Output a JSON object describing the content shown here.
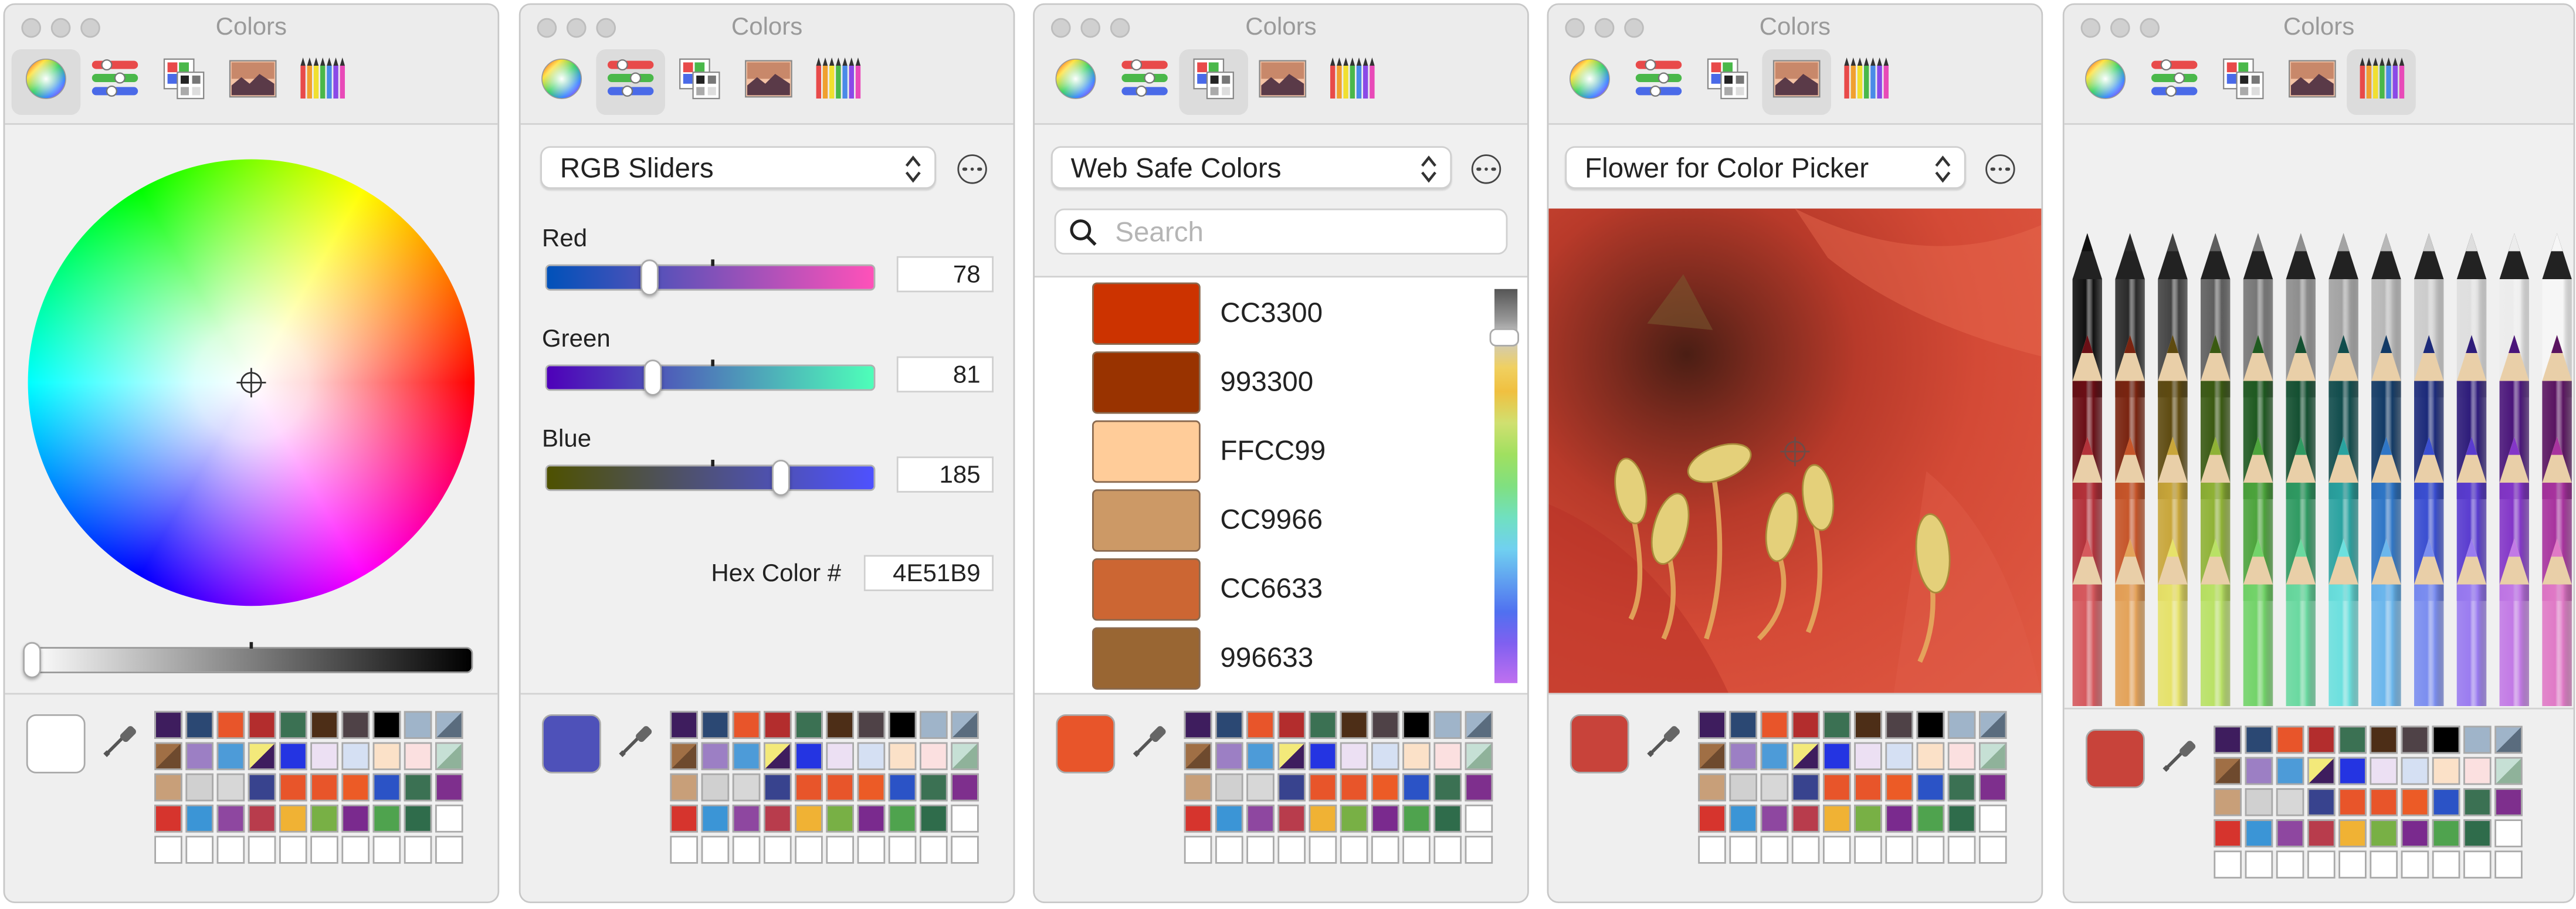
{
  "windows": [
    {
      "title": "Colors",
      "active_tab": 0
    },
    {
      "title": "Colors",
      "active_tab": 1
    },
    {
      "title": "Colors",
      "active_tab": 2
    },
    {
      "title": "Colors",
      "active_tab": 3
    },
    {
      "title": "Colors",
      "active_tab": 4
    }
  ],
  "toolbar_tabs": [
    "color-wheel-icon",
    "color-sliders-icon",
    "color-palettes-icon",
    "image-palettes-icon",
    "pencils-icon"
  ],
  "wheel": {
    "current_color": "#ffffff"
  },
  "sliders": {
    "mode": "RGB Sliders",
    "red_label": "Red",
    "red_value": "78",
    "green_label": "Green",
    "green_value": "81",
    "blue_label": "Blue",
    "blue_value": "185",
    "hex_label": "Hex Color #",
    "hex_value": "4E51B9",
    "current_color": "#4E51B9"
  },
  "palettes": {
    "list_name": "Web Safe Colors",
    "search_placeholder": "Search",
    "items": [
      {
        "name": "CC3300",
        "color": "#CC3300"
      },
      {
        "name": "993300",
        "color": "#993300"
      },
      {
        "name": "FFCC99",
        "color": "#FFCC99"
      },
      {
        "name": "CC9966",
        "color": "#CC9966"
      },
      {
        "name": "CC6633",
        "color": "#CC6633"
      },
      {
        "name": "996633",
        "color": "#996633"
      }
    ],
    "current_color": "#e8552a"
  },
  "image": {
    "image_name": "Flower for Color Picker",
    "current_color": "#c8433a"
  },
  "pencils": {
    "current_color": "#c8433a"
  },
  "favorites": [
    "#3e1d5e",
    "#2b4873",
    "#e8552a",
    "#b32d2d",
    "#3b7153",
    "#4d2e17",
    "#4f4247",
    "#000000",
    "#9fb4c9",
    "#8fb29a",
    "#a06f45",
    "#9c7fc4",
    "#4d9bd8",
    "#f3e97a",
    "#2434e2",
    "#ece0f3",
    "#d5e0f3",
    "#fbe1c8",
    "#fbe0e0",
    "#c6e0d5",
    "#c89f79",
    "#d0d0d0",
    "#d7d7d7",
    "#38438e",
    "#e8552a",
    "#e8552a",
    "#ec5b26",
    "#2b53c6",
    "#3b7153",
    "#7e2f8d",
    "#d6342d",
    "#3b95d6",
    "#8e47a0",
    "#b83c4c",
    "#f0b234",
    "#78b045",
    "#7a2a8e",
    "#4fa34e",
    "#2f6c4b",
    "#ffffff",
    "#ffffff",
    "#ffffff",
    "#ffffff",
    "#ffffff",
    "#ffffff",
    "#ffffff",
    "#ffffff",
    "#ffffff",
    "#ffffff",
    "#ffffff"
  ],
  "pencil_colors": [
    [
      "#111111",
      "#2a2a2a",
      "#444444",
      "#5e5e5e",
      "#777777",
      "#8e8e8e",
      "#a3a3a3",
      "#b8b8b8",
      "#cccccc",
      "#dedede",
      "#ececec",
      "#f6f6f6"
    ],
    [
      "#6b0f16",
      "#7a2410",
      "#5e4a10",
      "#3a5a12",
      "#1f5a20",
      "#145032",
      "#114d4d",
      "#123a66",
      "#1c2a7a",
      "#2e1c7a",
      "#4a157a",
      "#5a1460"
    ],
    [
      "#b3323a",
      "#c6562a",
      "#c9a63a",
      "#8fb236",
      "#4da43c",
      "#2f9a62",
      "#2aa3a0",
      "#2f76c6",
      "#3a4fd1",
      "#5a3ccf",
      "#8436c8",
      "#a8339e"
    ],
    [
      "#d65a5e",
      "#e3a35a",
      "#e6e26a",
      "#b9e166",
      "#73d46a",
      "#6ad9a0",
      "#6ce0de",
      "#6cb7ec",
      "#7b8ef0",
      "#9a7cf0",
      "#c27ae6",
      "#e07ac6"
    ]
  ]
}
